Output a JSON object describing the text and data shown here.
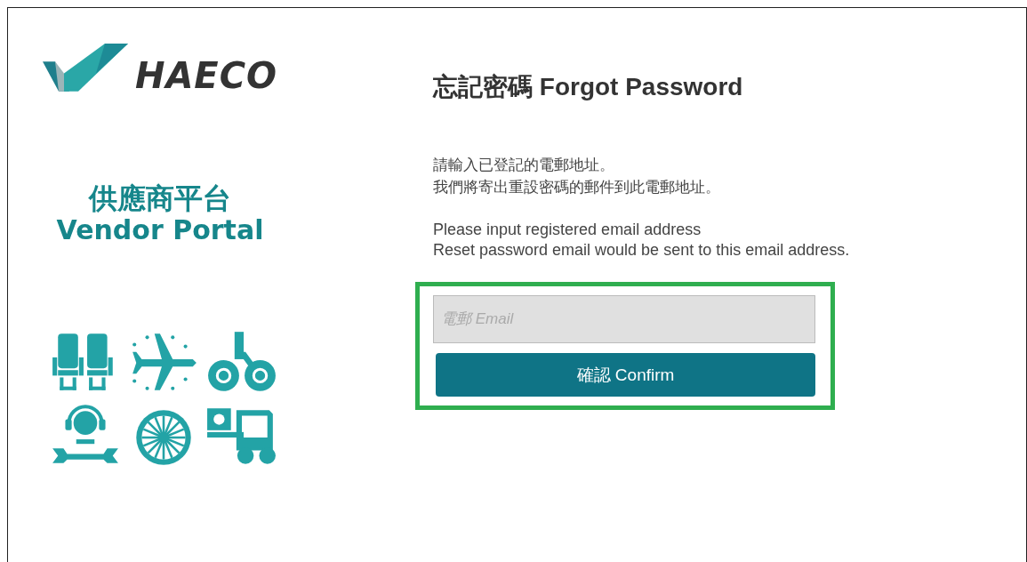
{
  "logo": {
    "text": "HAECO"
  },
  "portal": {
    "title_zh": "供應商平台",
    "title_en": "Vendor Portal"
  },
  "form": {
    "title": "忘記密碼 Forgot Password",
    "instructions_zh": [
      "請輸入已登記的電郵地址。",
      "我們將寄出重設密碼的郵件到此電郵地址。"
    ],
    "instructions_en": [
      "Please input registered email address",
      "Reset password email would be sent to this email address."
    ],
    "email": {
      "placeholder": "電郵 Email"
    },
    "confirm_button": "確認 Confirm",
    "highlighted": true
  }
}
